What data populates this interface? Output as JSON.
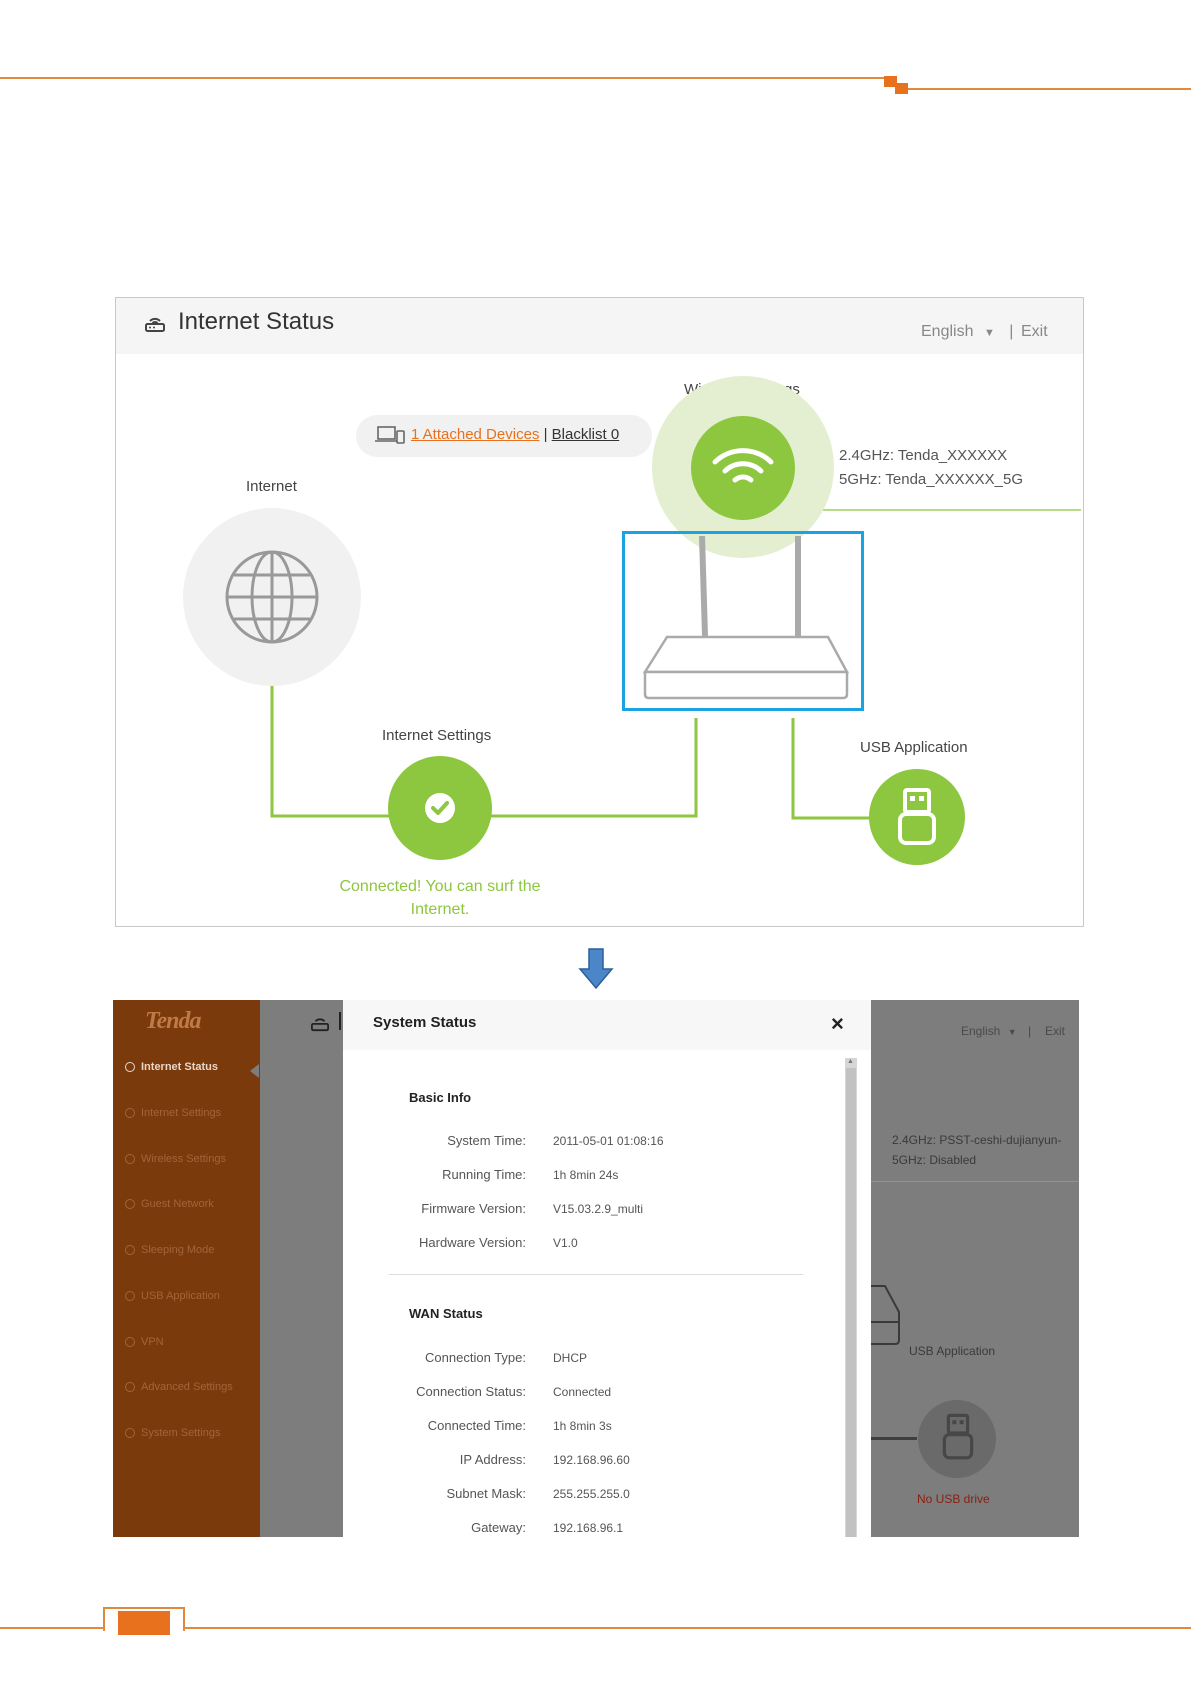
{
  "screenshot1": {
    "title": "Internet Status",
    "language": "English",
    "language_separator": "|",
    "exit": "Exit",
    "attached_devices": "1 Attached Devices",
    "link_separator": "|",
    "blacklist": "Blacklist 0",
    "internet_label": "Internet",
    "wireless_settings_label": "Wireless Settings",
    "ssid_24": "2.4GHz: Tenda_XXXXXX",
    "ssid_5": "5GHz: Tenda_XXXXXX_5G",
    "internet_settings_label": "Internet Settings",
    "connected_message": "Connected! You can surf the Internet.",
    "usb_application_label": "USB Application",
    "colors": {
      "accent_green": "#8dc63f",
      "highlight_blue": "#1aa3e0",
      "link_orange": "#e8711e"
    }
  },
  "screenshot2": {
    "logo": "Tenda",
    "sidebar": [
      {
        "label": "Internet Status",
        "icon": "router-icon",
        "active": true
      },
      {
        "label": "Internet Settings",
        "icon": "globe-icon",
        "active": false
      },
      {
        "label": "Wireless Settings",
        "icon": "wifi-icon",
        "active": false
      },
      {
        "label": "Guest Network",
        "icon": "guest-icon",
        "active": false
      },
      {
        "label": "Sleeping Mode",
        "icon": "bulb-icon",
        "active": false
      },
      {
        "label": "USB Application",
        "icon": "usb-icon",
        "active": false
      },
      {
        "label": "VPN",
        "icon": "vpn-icon",
        "active": false
      },
      {
        "label": "Advanced Settings",
        "icon": "tools-icon",
        "active": false
      },
      {
        "label": "System Settings",
        "icon": "gear-icon",
        "active": false
      }
    ],
    "background": {
      "language": "English",
      "language_separator": "|",
      "exit": "Exit",
      "ssid_24": "2.4GHz: PSST-ceshi-dujianyun-",
      "ssid_5": "5GHz: Disabled",
      "usb_application_label": "USB Application",
      "no_usb": "No USB drive"
    },
    "modal": {
      "title": "System Status",
      "close": "×",
      "basic_info": {
        "title": "Basic Info",
        "rows": [
          {
            "label": "System Time:",
            "value": "2011-05-01 01:08:16"
          },
          {
            "label": "Running Time:",
            "value": "1h 8min 24s"
          },
          {
            "label": "Firmware Version:",
            "value": "V15.03.2.9_multi"
          },
          {
            "label": "Hardware Version:",
            "value": "V1.0"
          }
        ]
      },
      "wan_status": {
        "title": "WAN Status",
        "rows": [
          {
            "label": "Connection Type:",
            "value": "DHCP"
          },
          {
            "label": "Connection Status:",
            "value": "Connected"
          },
          {
            "label": "Connected Time:",
            "value": "1h 8min 3s"
          },
          {
            "label": "IP Address:",
            "value": "192.168.96.60"
          },
          {
            "label": "Subnet Mask:",
            "value": "255.255.255.0"
          },
          {
            "label": "Gateway:",
            "value": "192.168.96.1"
          }
        ]
      }
    }
  }
}
